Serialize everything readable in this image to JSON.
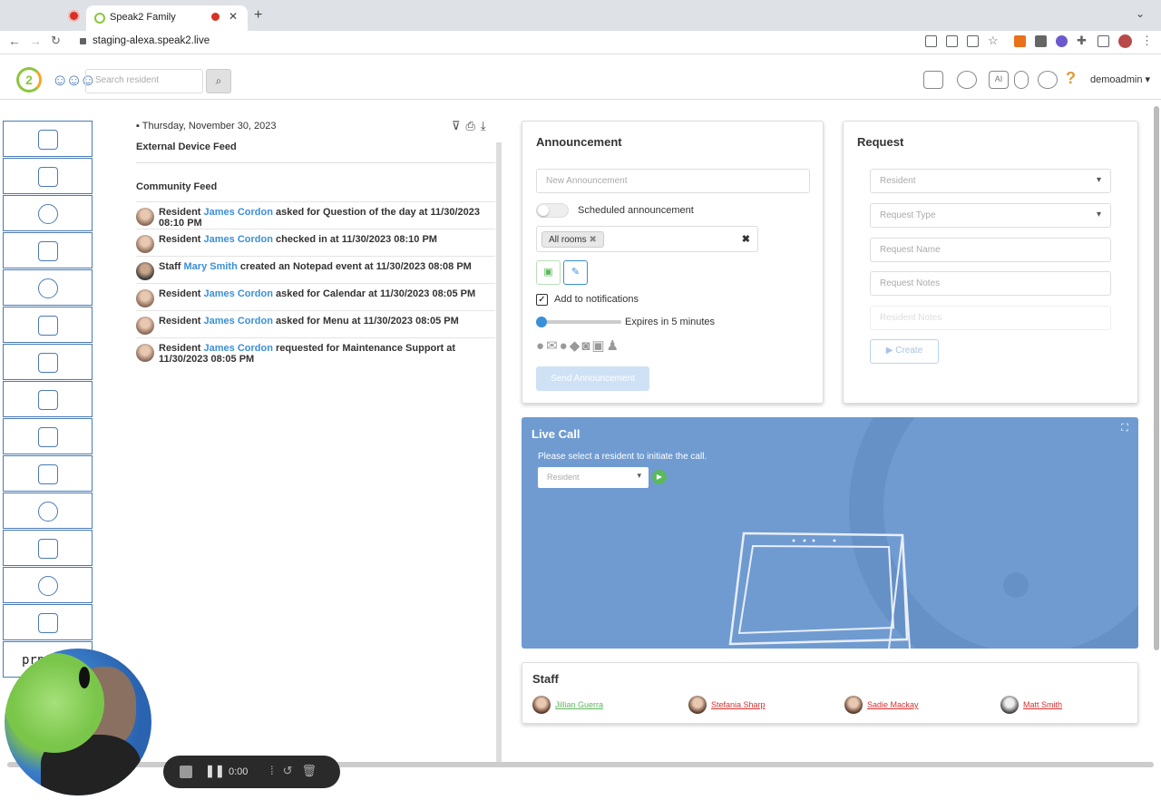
{
  "browser": {
    "tab_title": "Speak2 Family",
    "url": "staging-alexa.speak2.live"
  },
  "header": {
    "logo_text": "2",
    "search_placeholder": "Search resident",
    "username": "demoadmin",
    "help": "?"
  },
  "sidebar": {
    "last_item_text": "prnt"
  },
  "feed": {
    "date": "Thursday, November 30, 2023",
    "external_title": "External Device Feed",
    "community_title": "Community Feed",
    "items": [
      {
        "role": "Resident",
        "name": "James Cordon",
        "text": "asked for Question of the day at 11/30/2023 08:10 PM"
      },
      {
        "role": "Resident",
        "name": "James Cordon",
        "text": "checked in at 11/30/2023 08:10 PM"
      },
      {
        "role": "Staff",
        "name": "Mary Smith",
        "text": "created an Notepad event at 11/30/2023 08:08 PM"
      },
      {
        "role": "Resident",
        "name": "James Cordon",
        "text": "asked for Calendar at 11/30/2023 08:05 PM"
      },
      {
        "role": "Resident",
        "name": "James Cordon",
        "text": "asked for Menu at 11/30/2023 08:05 PM"
      },
      {
        "role": "Resident",
        "name": "James Cordon",
        "text": "requested for Maintenance Support at 11/30/2023 08:05 PM"
      }
    ]
  },
  "announcement": {
    "title": "Announcement",
    "placeholder": "New Announcement",
    "scheduled_label": "Scheduled announcement",
    "room_chip": "All rooms",
    "notify_label": "Add to notifications",
    "expires_label": "Expires in 5 minutes",
    "expires_fraction": 0.0,
    "send_label": "Send Announcement"
  },
  "request": {
    "title": "Request",
    "resident_placeholder": "Resident",
    "type_placeholder": "Request Type",
    "name_placeholder": "Request Name",
    "notes_placeholder": "Request Notes",
    "resident_notes_placeholder": "Resident Notes",
    "create_label": "Create"
  },
  "live_call": {
    "title": "Live Call",
    "subtitle": "Please select a resident to initiate the call.",
    "select_placeholder": "Resident"
  },
  "staff": {
    "title": "Staff",
    "members": [
      {
        "name": "Jillian Guerra",
        "color": "#5cb85c"
      },
      {
        "name": "Stefania Sharp",
        "color": "#d9302f"
      },
      {
        "name": "Sadie Mackay",
        "color": "#d9302f"
      },
      {
        "name": "Matt Smith",
        "color": "#d9302f"
      }
    ]
  },
  "recorder": {
    "time": "0:00"
  }
}
